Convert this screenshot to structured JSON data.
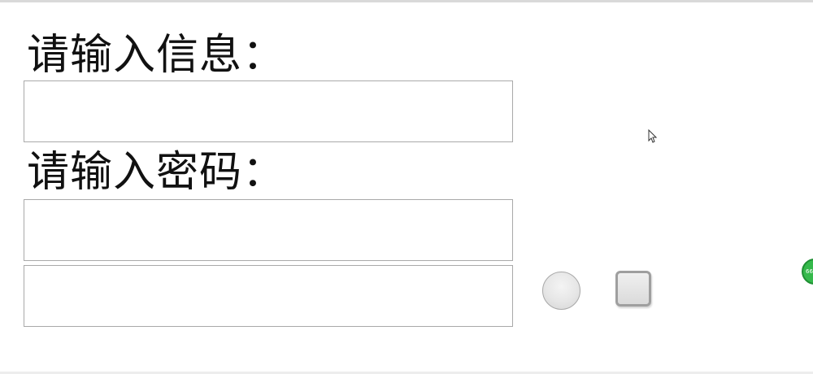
{
  "form": {
    "info_label": "请输入信息：",
    "info_input": {
      "value": "",
      "placeholder": ""
    },
    "password_label": "请输入密码：",
    "password_input": {
      "value": "",
      "placeholder": ""
    },
    "third_input": {
      "value": "",
      "placeholder": ""
    }
  },
  "controls": {
    "radio": {
      "checked": false
    },
    "checkbox": {
      "checked": false
    }
  },
  "badge": {
    "text": "66"
  },
  "icons": {
    "cursor": "mouse-pointer-icon"
  },
  "colors": {
    "input_border": "#a9a9a9",
    "label_text": "#111111",
    "badge_green": "#35b94b"
  }
}
